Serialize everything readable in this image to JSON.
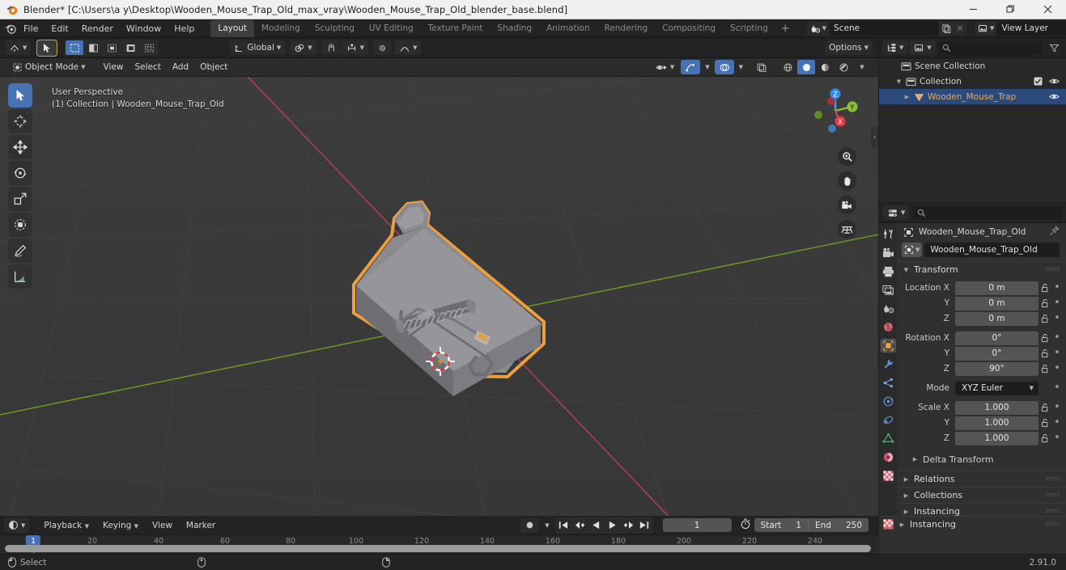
{
  "window": {
    "title": "Blender* [C:\\Users\\a y\\Desktop\\Wooden_Mouse_Trap_Old_max_vray\\Wooden_Mouse_Trap_Old_blender_base.blend]",
    "minimize": "minimize-icon",
    "maximize": "maximize-icon",
    "close": "close-icon"
  },
  "topbar": {
    "menus": [
      "File",
      "Edit",
      "Render",
      "Window",
      "Help"
    ],
    "workspaces": [
      {
        "label": "Layout",
        "active": true
      },
      {
        "label": "Modeling",
        "active": false
      },
      {
        "label": "Sculpting",
        "active": false
      },
      {
        "label": "UV Editing",
        "active": false
      },
      {
        "label": "Texture Paint",
        "active": false
      },
      {
        "label": "Shading",
        "active": false
      },
      {
        "label": "Animation",
        "active": false
      },
      {
        "label": "Rendering",
        "active": false
      },
      {
        "label": "Compositing",
        "active": false
      },
      {
        "label": "Scripting",
        "active": false
      }
    ],
    "add_workspace": "+",
    "scene_name": "Scene",
    "view_layer_name": "View Layer"
  },
  "viewport": {
    "editor_type": "editor-type-icon",
    "mode": "Object Mode",
    "menus": [
      "View",
      "Select",
      "Add",
      "Object"
    ],
    "transform_orientation": "Global",
    "options_label": "Options",
    "overlay_line1": "User Perspective",
    "overlay_line2": "(1) Collection | Wooden_Mouse_Trap_Old",
    "gizmo_axes": [
      "X",
      "Y",
      "Z"
    ],
    "tools": [
      {
        "name": "tweak-tool",
        "active": true
      },
      {
        "name": "cursor-tool",
        "active": false
      },
      {
        "name": "move-tool",
        "active": false
      },
      {
        "name": "rotate-tool",
        "active": false
      },
      {
        "name": "scale-tool",
        "active": false
      },
      {
        "name": "transform-tool",
        "active": false
      },
      {
        "name": "annotate-tool",
        "active": false
      },
      {
        "name": "measure-tool",
        "active": false
      }
    ],
    "nav_buttons": [
      "zoom-icon",
      "hand-icon",
      "camera-icon",
      "grid-icon"
    ],
    "shading_modes": [
      "wireframe",
      "solid",
      "material-preview",
      "rendered"
    ],
    "active_shading": "solid"
  },
  "outliner": {
    "display_mode": "view-layer-icon",
    "filter_icon": "filter-icon",
    "search_placeholder": "",
    "rows": [
      {
        "label": "Scene Collection",
        "icon": "collection-icon",
        "indent": 0,
        "selected": false,
        "expander": "",
        "checkbox": false,
        "eye": false
      },
      {
        "label": "Collection",
        "icon": "collection-icon",
        "indent": 1,
        "selected": false,
        "expander": "down",
        "checkbox": true,
        "eye": true
      },
      {
        "label": "Wooden_Mouse_Trap",
        "icon": "mesh-object-icon",
        "indent": 2,
        "selected": true,
        "expander": "right",
        "checkbox": false,
        "eye": true
      }
    ]
  },
  "properties": {
    "editor_type": "properties-icon",
    "search_placeholder": "",
    "breadcrumb_object": "Wooden_Mouse_Trap_Old",
    "pin_icon": "pin-icon",
    "object_name": "Wooden_Mouse_Trap_Old",
    "tabs": [
      {
        "name": "tool-tab",
        "glyph": "tool",
        "active": false
      },
      {
        "name": "render-tab",
        "glyph": "render",
        "active": false
      },
      {
        "name": "output-tab",
        "glyph": "output",
        "active": false
      },
      {
        "name": "view-layer-tab",
        "glyph": "viewlayer",
        "active": false
      },
      {
        "name": "scene-tab",
        "glyph": "scene",
        "active": false
      },
      {
        "name": "world-tab",
        "glyph": "world",
        "active": false
      },
      {
        "name": "object-tab",
        "glyph": "object",
        "active": true
      },
      {
        "name": "modifier-tab",
        "glyph": "wrench",
        "active": false
      },
      {
        "name": "particles-tab",
        "glyph": "particles",
        "active": false
      },
      {
        "name": "physics-tab",
        "glyph": "physics",
        "active": false
      },
      {
        "name": "constraints-tab",
        "glyph": "constraint",
        "active": false
      },
      {
        "name": "data-tab",
        "glyph": "data",
        "active": false
      },
      {
        "name": "material-tab",
        "glyph": "material",
        "active": false
      },
      {
        "name": "texture-tab",
        "glyph": "texture",
        "active": false
      }
    ],
    "transform": {
      "panel_label": "Transform",
      "location": {
        "label": "Location X",
        "sub": [
          "Y",
          "Z"
        ],
        "values": [
          "0 m",
          "0 m",
          "0 m"
        ]
      },
      "rotation": {
        "label": "Rotation X",
        "sub": [
          "Y",
          "Z"
        ],
        "values": [
          "0°",
          "0°",
          "90°"
        ]
      },
      "mode": {
        "label": "Mode",
        "value": "XYZ Euler"
      },
      "scale": {
        "label": "Scale X",
        "sub": [
          "Y",
          "Z"
        ],
        "values": [
          "1.000",
          "1.000",
          "1.000"
        ]
      },
      "delta_transform": "Delta Transform"
    },
    "panels": [
      "Relations",
      "Collections",
      "Instancing"
    ]
  },
  "timeline": {
    "editor_type": "timeline-icon",
    "menus": [
      "Playback",
      "Keying",
      "View",
      "Marker"
    ],
    "record_icon": "record-icon",
    "transport": [
      "jump-start-icon",
      "prev-keyframe-icon",
      "play-reverse-icon",
      "play-icon",
      "next-keyframe-icon",
      "jump-end-icon"
    ],
    "current_frame": "1",
    "autokey_icon": "stopwatch-icon",
    "start_label": "Start",
    "start_value": "1",
    "end_label": "End",
    "end_value": "250",
    "ticks": [
      "20",
      "40",
      "60",
      "80",
      "100",
      "120",
      "140",
      "160",
      "180",
      "200",
      "220",
      "240"
    ],
    "playhead_frame": "1"
  },
  "statusbar": {
    "mouse_left": "mouse-left-icon",
    "select_label": "Select",
    "mouse_middle": "mouse-middle-icon",
    "mouse_right": "mouse-right-icon",
    "version": "2.91.0"
  },
  "colors": {
    "accent": "#4772b3",
    "selected_outline": "#ed9e3e",
    "viewport_bg": "#393939",
    "panel_bg": "#303030",
    "header_bg": "#232323",
    "field_bg": "#545454",
    "axis_x": "#c0415b",
    "axis_y": "#6fa521"
  }
}
